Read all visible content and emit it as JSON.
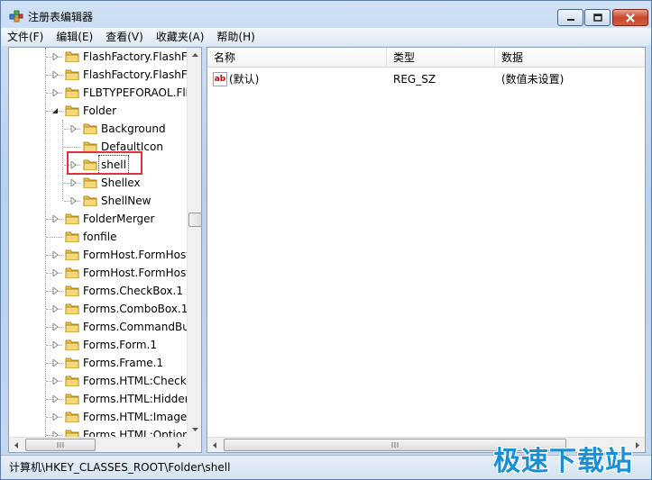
{
  "window": {
    "title": "注册表编辑器"
  },
  "menu": [
    "文件(F)",
    "编辑(E)",
    "查看(V)",
    "收藏夹(A)",
    "帮助(H)"
  ],
  "tree": {
    "items": [
      {
        "label": "FlashFactory.FlashFa",
        "level": 0,
        "expander": "collapsed"
      },
      {
        "label": "FlashFactory.FlashFa",
        "level": 0,
        "expander": "collapsed"
      },
      {
        "label": "FLBTYPEFORAOL.Flb",
        "level": 0,
        "expander": "collapsed"
      },
      {
        "label": "Folder",
        "level": 0,
        "expander": "expanded"
      },
      {
        "label": "Background",
        "level": 1,
        "expander": "collapsed"
      },
      {
        "label": "DefaultIcon",
        "level": 1,
        "expander": "none"
      },
      {
        "label": "shell",
        "level": 1,
        "expander": "collapsed",
        "selected": true
      },
      {
        "label": "Shellex",
        "level": 1,
        "expander": "collapsed"
      },
      {
        "label": "ShellNew",
        "level": 1,
        "expander": "collapsed"
      },
      {
        "label": "FolderMerger",
        "level": 0,
        "expander": "collapsed"
      },
      {
        "label": "fonfile",
        "level": 0,
        "expander": "none"
      },
      {
        "label": "FormHost.FormHost",
        "level": 0,
        "expander": "collapsed"
      },
      {
        "label": "FormHost.FormHost",
        "level": 0,
        "expander": "collapsed"
      },
      {
        "label": "Forms.CheckBox.1",
        "level": 0,
        "expander": "collapsed"
      },
      {
        "label": "Forms.ComboBox.1",
        "level": 0,
        "expander": "collapsed"
      },
      {
        "label": "Forms.CommandBu",
        "level": 0,
        "expander": "collapsed"
      },
      {
        "label": "Forms.Form.1",
        "level": 0,
        "expander": "collapsed"
      },
      {
        "label": "Forms.Frame.1",
        "level": 0,
        "expander": "collapsed"
      },
      {
        "label": "Forms.HTML:Checkb",
        "level": 0,
        "expander": "collapsed"
      },
      {
        "label": "Forms.HTML:Hidden",
        "level": 0,
        "expander": "collapsed"
      },
      {
        "label": "Forms.HTML:Image",
        "level": 0,
        "expander": "collapsed"
      },
      {
        "label": "Forms.HTML:Option",
        "level": 0,
        "expander": "collapsed"
      }
    ]
  },
  "list": {
    "columns": [
      "名称",
      "类型",
      "数据"
    ],
    "rows": [
      {
        "name": "(默认)",
        "type": "REG_SZ",
        "data": "(数值未设置)"
      }
    ]
  },
  "status": {
    "path": "计算机\\HKEY_CLASSES_ROOT\\Folder\\shell"
  },
  "watermark": {
    "text": "极速下载站"
  },
  "colors": {
    "highlight_box": "#e0313c",
    "watermark": "#1b8fd3"
  }
}
